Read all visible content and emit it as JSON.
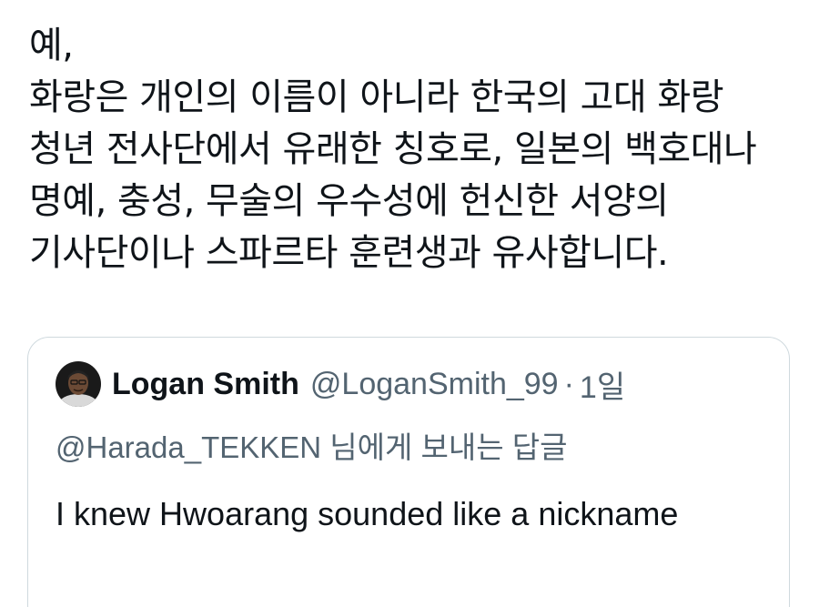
{
  "tweet": {
    "lines": [
      "예,",
      "화랑은 개인의 이름이 아니라 한국의 고대 화랑",
      "청년 전사단에서 유래한 칭호로, 일본의 백호대나",
      "명예, 충성, 무술의 우수성에 헌신한 서양의",
      "기사단이나 스파르타 훈련생과 유사합니다."
    ]
  },
  "quote": {
    "author_name": "Logan Smith",
    "author_handle": "@LoganSmith_99",
    "separator": "·",
    "time": "1일",
    "reply_mention": "@Harada_TEKKEN",
    "reply_suffix": " 님에게 보내는 답글",
    "text": "I knew Hwoarang sounded like a nickname"
  },
  "colors": {
    "text": "#0f1419",
    "secondary": "#536471",
    "border": "#cfd9de"
  }
}
